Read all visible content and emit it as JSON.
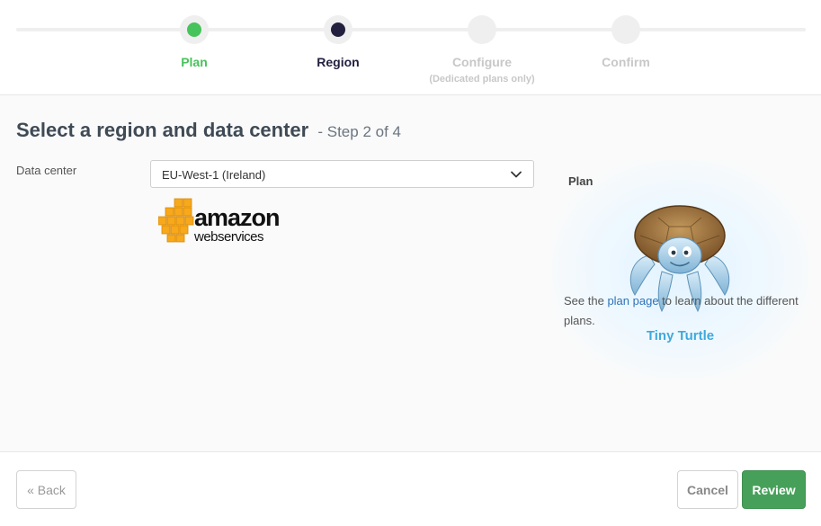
{
  "steps": [
    {
      "label": "Plan",
      "sublabel": ""
    },
    {
      "label": "Region",
      "sublabel": ""
    },
    {
      "label": "Configure",
      "sublabel": "(Dedicated plans only)"
    },
    {
      "label": "Confirm",
      "sublabel": ""
    }
  ],
  "page": {
    "title": "Select a region and data center",
    "step_indicator": "- Step 2 of 4"
  },
  "form": {
    "datacenter_label": "Data center",
    "datacenter_value": "EU-West-1 (Ireland)",
    "provider_logo_word": "amazon",
    "provider_logo_sub": "webservices"
  },
  "plan": {
    "heading": "Plan",
    "name": "Tiny Turtle",
    "help_prefix": "See the ",
    "help_link": "plan page",
    "help_suffix": " to learn about the different plans."
  },
  "footer": {
    "back_label": "« Back",
    "cancel_label": "Cancel",
    "review_label": "Review"
  },
  "colors": {
    "step_done": "#47c35b",
    "step_active": "#23203f",
    "step_todo": "#c8c8c8",
    "plan_name": "#3fa9dc",
    "review_button": "#47a05a",
    "link": "#2d73b8"
  }
}
